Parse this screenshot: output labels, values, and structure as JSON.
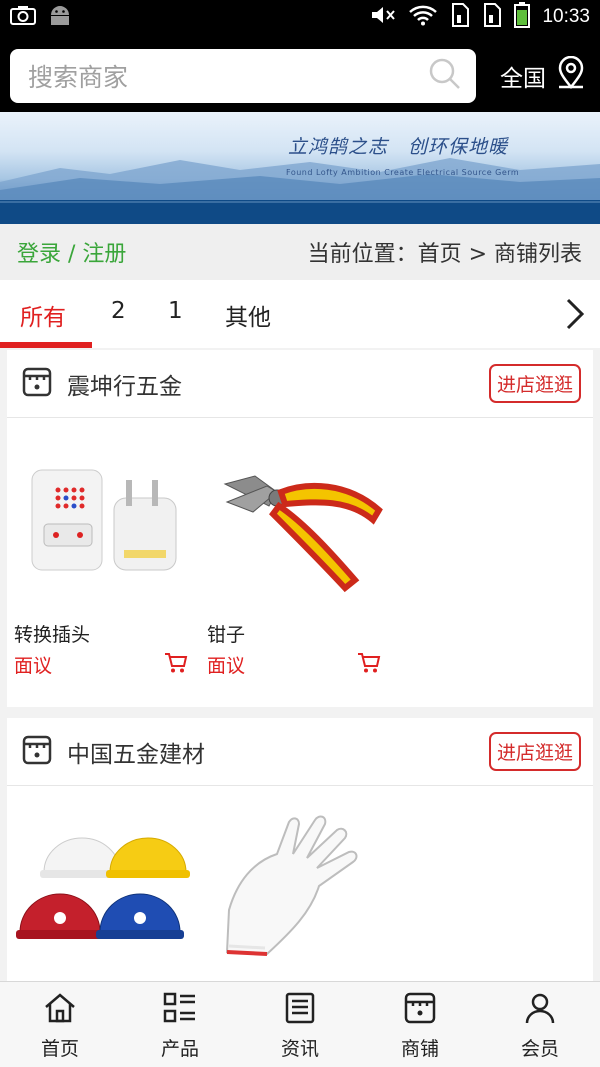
{
  "status_bar": {
    "time": "10:33"
  },
  "search": {
    "placeholder": "搜索商家",
    "region": "全国"
  },
  "banner": {
    "title": "立鸿鹄之志　创环保地暖",
    "subtitle": "Found Lofty Ambition Create Electrical Source Germ"
  },
  "crumb": {
    "login": "登录 / 注册",
    "location": "当前位置：首页 > 商铺列表"
  },
  "tabs": [
    "所有",
    "2",
    "1",
    "其他"
  ],
  "shops": [
    {
      "name": "震坤行五金",
      "visit_label": "进店逛逛",
      "products": [
        {
          "name": "转换插头",
          "price": "面议"
        },
        {
          "name": "钳子",
          "price": "面议"
        }
      ]
    },
    {
      "name": "中国五金建材",
      "visit_label": "进店逛逛",
      "products": []
    }
  ],
  "bottom_nav": [
    "首页",
    "产品",
    "资讯",
    "商铺",
    "会员"
  ],
  "colors": {
    "accent": "#e02020",
    "login": "#3aa63a",
    "topbar": "#000000"
  }
}
